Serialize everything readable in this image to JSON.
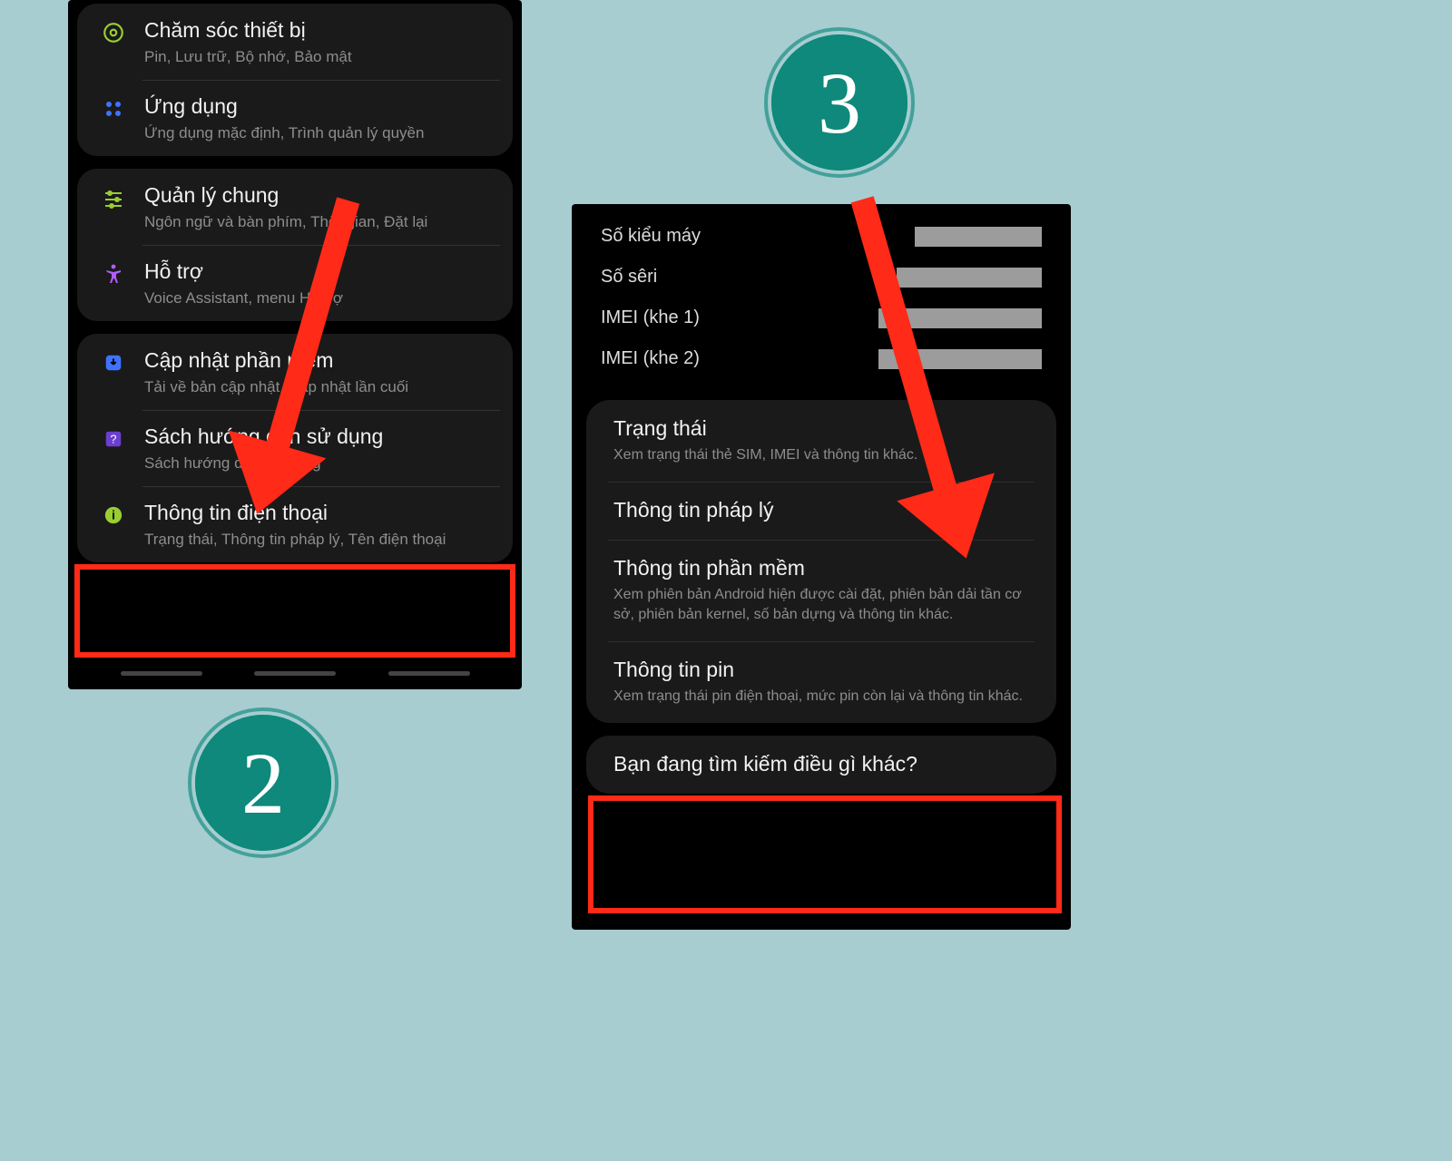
{
  "step2_badge": "2",
  "step3_badge": "3",
  "left": {
    "g1": {
      "r0": {
        "title": "Chăm sóc thiết bị",
        "sub": "Pin, Lưu trữ, Bộ nhớ, Bảo mật"
      },
      "r1": {
        "title": "Ứng dụng",
        "sub": "Ứng dụng mặc định, Trình quản lý quyền"
      }
    },
    "g2": {
      "r0": {
        "title": "Quản lý chung",
        "sub": "Ngôn ngữ và bàn phím, Thời gian, Đặt lại"
      },
      "r1": {
        "title": "Hỗ trợ",
        "sub": "Voice Assistant, menu Hỗ trợ"
      }
    },
    "g3": {
      "r0": {
        "title": "Cập nhật phần mềm",
        "sub": "Tải về bản cập nhật, Cập nhật lần cuối"
      },
      "r1": {
        "title": "Sách hướng dẫn sử dụng",
        "sub": "Sách hướng dẫn sử dụng"
      },
      "r2": {
        "title": "Thông tin điện thoại",
        "sub": "Trạng thái, Thông tin pháp lý, Tên điện thoại"
      }
    }
  },
  "right": {
    "info": {
      "model": "Số kiểu máy",
      "serial": "Số sêri",
      "imei1": "IMEI (khe 1)",
      "imei2": "IMEI (khe 2)"
    },
    "g1": {
      "r0": {
        "title": "Trạng thái",
        "sub": "Xem trạng thái thẻ SIM, IMEI và thông tin khác."
      },
      "r1": {
        "title": "Thông tin pháp lý",
        "sub": ""
      },
      "r2": {
        "title": "Thông tin phần mềm",
        "sub": "Xem phiên bản Android hiện được cài đặt, phiên bản dải tần cơ sở, phiên bản kernel, số bản dựng và thông tin khác."
      },
      "r3": {
        "title": "Thông tin pin",
        "sub": "Xem trạng thái pin điện thoại, mức pin còn lại và thông tin khác."
      }
    },
    "g2": {
      "r0": {
        "title": "Bạn đang tìm kiếm điều gì khác?"
      }
    }
  }
}
